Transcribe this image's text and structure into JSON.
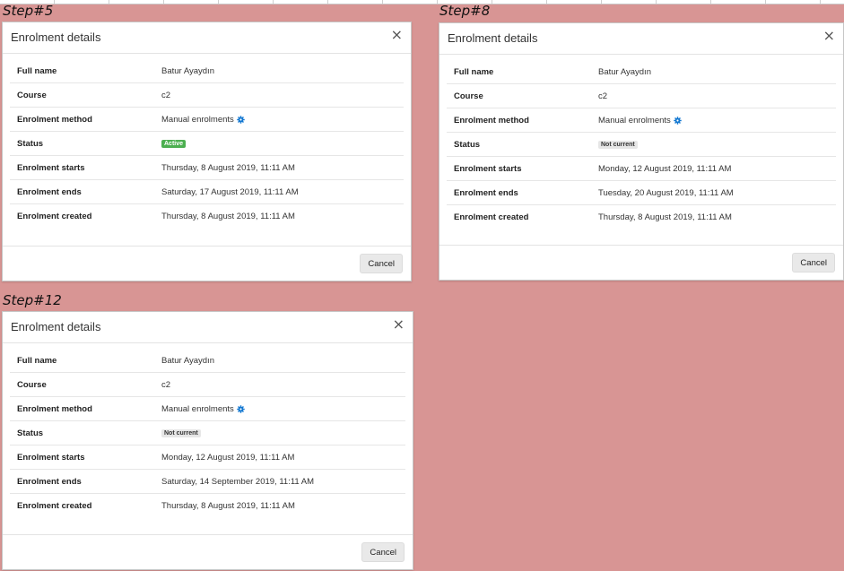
{
  "accent_color": "#1177d1",
  "panels": [
    {
      "step_label": "Step#5",
      "title": "Enrolment details",
      "close_symbol": "×",
      "rows": [
        {
          "label": "Full name",
          "value": "Batur Ayaydın"
        },
        {
          "label": "Course",
          "value": "c2"
        },
        {
          "label": "Enrolment method",
          "value": "Manual enrolments",
          "icon": "gear-icon"
        },
        {
          "label": "Status",
          "badge": "Active"
        },
        {
          "label": "Enrolment starts",
          "value": "Thursday, 8 August 2019, 11:11 AM"
        },
        {
          "label": "Enrolment ends",
          "value": "Saturday, 17 August 2019, 11:11 AM"
        },
        {
          "label": "Enrolment created",
          "value": "Thursday, 8 August 2019, 11:11 AM"
        }
      ],
      "cancel_label": "Cancel"
    },
    {
      "step_label": "Step#8",
      "title": "Enrolment details",
      "close_symbol": "×",
      "rows": [
        {
          "label": "Full name",
          "value": "Batur Ayaydın"
        },
        {
          "label": "Course",
          "value": "c2"
        },
        {
          "label": "Enrolment method",
          "value": "Manual enrolments",
          "icon": "gear-icon"
        },
        {
          "label": "Status",
          "badge": "Not current"
        },
        {
          "label": "Enrolment starts",
          "value": "Monday, 12 August 2019, 11:11 AM"
        },
        {
          "label": "Enrolment ends",
          "value": "Tuesday, 20 August 2019, 11:11 AM"
        },
        {
          "label": "Enrolment created",
          "value": "Thursday, 8 August 2019, 11:11 AM"
        }
      ],
      "cancel_label": "Cancel"
    },
    {
      "step_label": "Step#12",
      "title": "Enrolment details",
      "close_symbol": "×",
      "rows": [
        {
          "label": "Full name",
          "value": "Batur Ayaydın"
        },
        {
          "label": "Course",
          "value": "c2"
        },
        {
          "label": "Enrolment method",
          "value": "Manual enrolments",
          "icon": "gear-icon"
        },
        {
          "label": "Status",
          "badge": "Not current"
        },
        {
          "label": "Enrolment starts",
          "value": "Monday, 12 August 2019, 11:11 AM"
        },
        {
          "label": "Enrolment ends",
          "value": "Saturday, 14 September 2019, 11:11 AM"
        },
        {
          "label": "Enrolment created",
          "value": "Thursday, 8 August 2019, 11:11 AM"
        }
      ],
      "cancel_label": "Cancel"
    }
  ]
}
